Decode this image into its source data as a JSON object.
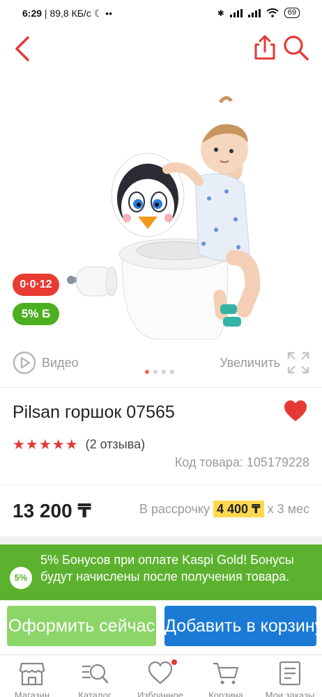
{
  "status_bar": {
    "time": "6:29",
    "network_speed": "89,8 КБ/с",
    "dots": "••",
    "battery": "69"
  },
  "product": {
    "title": "Pilsan горшок 07565",
    "rating_stars": "★★★★★",
    "rating": 5,
    "reviews": "(2 отзыва)",
    "sku": "Код товара: 105179228",
    "price": "13 200 ₸",
    "installment_prefix": "В рассрочку",
    "installment_amount": "4 400 ₸",
    "installment_suffix": "x 3 мес"
  },
  "badges": {
    "installment": "0·0·12",
    "bonus": "5% Б"
  },
  "gallery": {
    "video_label": "Видео",
    "zoom_label": "Увеличить",
    "image_count": 4,
    "active_index": 0
  },
  "bonus_banner": {
    "icon_text": "5%",
    "text": "5% Бонусов при оплате Kaspi Gold! Бонусы будут начислены после получения товара."
  },
  "actions": {
    "buy_now": "Оформить сейчас",
    "add_to_cart": "Добавить в корзину"
  },
  "bottom_nav": {
    "items": [
      {
        "label": "Магазин",
        "icon": "store-icon"
      },
      {
        "label": "Каталог",
        "icon": "catalog-search-icon"
      },
      {
        "label": "Избранное",
        "icon": "heart-icon"
      },
      {
        "label": "Корзина",
        "icon": "cart-icon"
      },
      {
        "label": "Мои заказы",
        "icon": "orders-icon"
      }
    ]
  },
  "colors": {
    "accent_red": "#e53935",
    "bonus_green": "#5cb22e",
    "buy_green": "#8cd568",
    "cart_blue": "#1a7ad4",
    "highlight_yellow": "#ffd84d"
  }
}
